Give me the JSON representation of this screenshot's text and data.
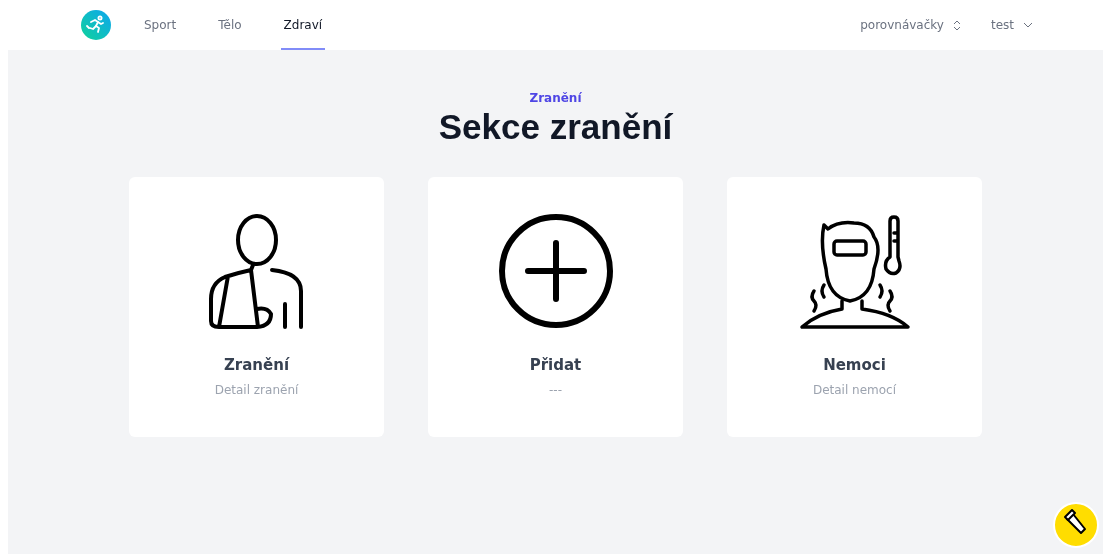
{
  "nav": {
    "tabs": [
      {
        "label": "Sport",
        "selected": false
      },
      {
        "label": "Tělo",
        "selected": false
      },
      {
        "label": "Zdraví",
        "selected": true
      }
    ],
    "menus": [
      {
        "label": "porovnávačky",
        "kind": "updown"
      },
      {
        "label": "test",
        "kind": "down"
      }
    ]
  },
  "header": {
    "eyebrow": "Zranění",
    "title": "Sekce zranění"
  },
  "cards": [
    {
      "kind": "injury",
      "title": "Zranění",
      "subtitle": "Detail zranění"
    },
    {
      "kind": "add",
      "title": "Přidat",
      "subtitle": "---"
    },
    {
      "kind": "sick",
      "title": "Nemoci",
      "subtitle": "Detail nemocí"
    }
  ]
}
